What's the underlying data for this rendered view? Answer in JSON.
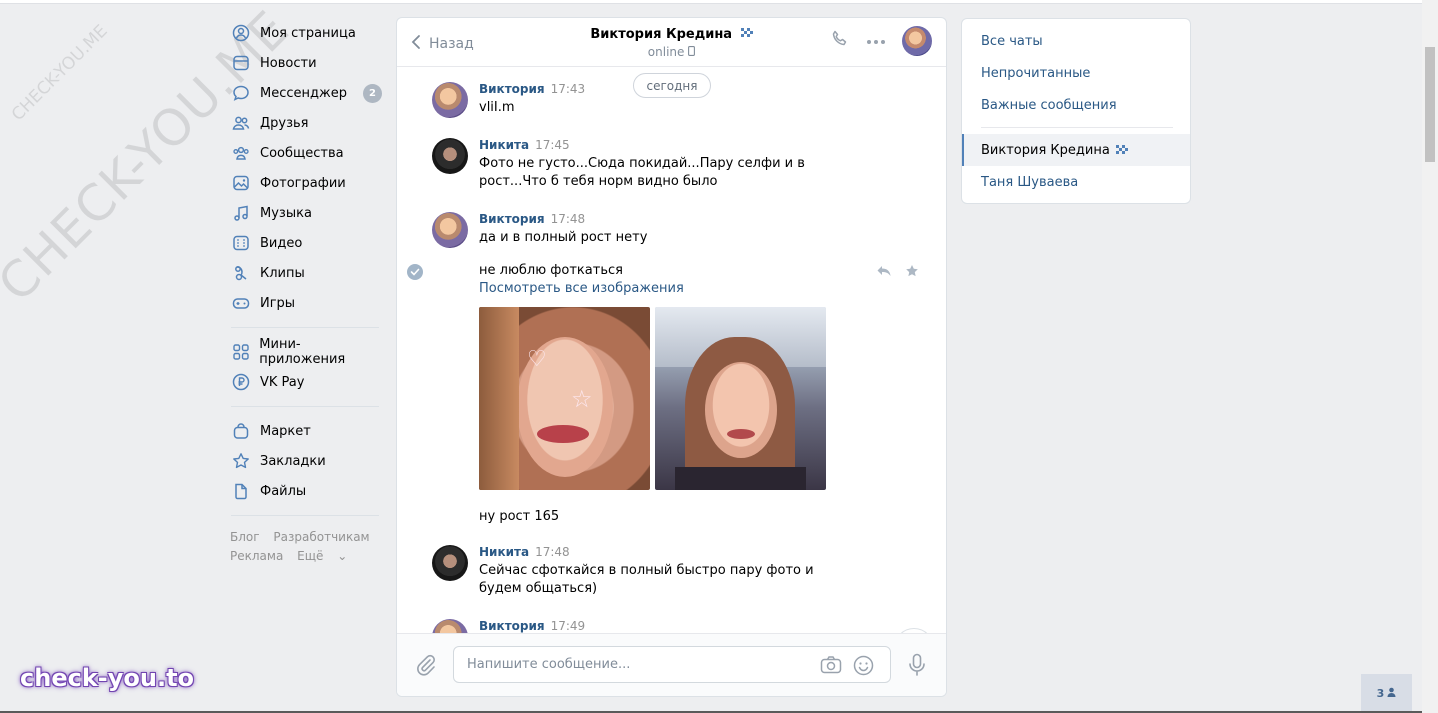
{
  "watermarks": {
    "small": "CHECK-YOU.ME",
    "large": "CHECK-YOU.ME",
    "brand": "check-you.to"
  },
  "leftnav": {
    "items": [
      {
        "label": "Моя страница",
        "icon": "user-circle-icon"
      },
      {
        "label": "Новости",
        "icon": "news-icon"
      },
      {
        "label": "Мессенджер",
        "icon": "chat-bubble-icon",
        "badge": "2"
      },
      {
        "label": "Друзья",
        "icon": "friends-icon"
      },
      {
        "label": "Сообщества",
        "icon": "communities-icon"
      },
      {
        "label": "Фотографии",
        "icon": "photo-icon"
      },
      {
        "label": "Музыка",
        "icon": "music-icon"
      },
      {
        "label": "Видео",
        "icon": "video-icon"
      },
      {
        "label": "Клипы",
        "icon": "clips-icon"
      },
      {
        "label": "Игры",
        "icon": "gamepad-icon"
      }
    ],
    "items2": [
      {
        "label": "Мини-приложения",
        "icon": "apps-grid-icon"
      },
      {
        "label": "VK Pay",
        "icon": "vkpay-icon"
      }
    ],
    "items3": [
      {
        "label": "Маркет",
        "icon": "bag-icon"
      },
      {
        "label": "Закладки",
        "icon": "star-icon"
      },
      {
        "label": "Файлы",
        "icon": "file-icon"
      }
    ],
    "footer": {
      "blog": "Блог",
      "dev": "Разработчикам",
      "ads": "Реклама",
      "more": "Ещё"
    }
  },
  "chat": {
    "back_label": "Назад",
    "peer_name": "Виктория Кредина",
    "peer_status": "online",
    "date_divider": "сегодня",
    "messages": [
      {
        "author": "Виктория",
        "time": "17:43",
        "text": "vliI.m"
      },
      {
        "author": "Никита",
        "time": "17:45",
        "text": "Фото не густо...Сюда покидай...Пару селфи и в рост...Что б тебя норм видно было"
      },
      {
        "author": "Виктория",
        "time": "17:48",
        "text": "да и в полный рост нету"
      },
      {
        "text": "не люблю фоткаться"
      },
      {
        "link": "Посмотреть все изображения"
      },
      {
        "text": "ну рост 165"
      },
      {
        "author": "Никита",
        "time": "17:48",
        "text": "Сейчас сфоткайся в полный быстро пару фото и будем общаться)"
      },
      {
        "author": "Виктория",
        "time": "17:49"
      }
    ],
    "compose_placeholder": "Напишите сообщение..."
  },
  "rightpanel": {
    "filters": [
      "Все чаты",
      "Непрочитанные",
      "Важные сообщения"
    ],
    "chats": [
      "Виктория Кредина",
      "Таня Шуваева"
    ],
    "active_chat_index": 0
  },
  "people_count": "3",
  "colors": {
    "link": "#2a5885",
    "bg": "#edeef0",
    "accent": "#5181b8"
  }
}
